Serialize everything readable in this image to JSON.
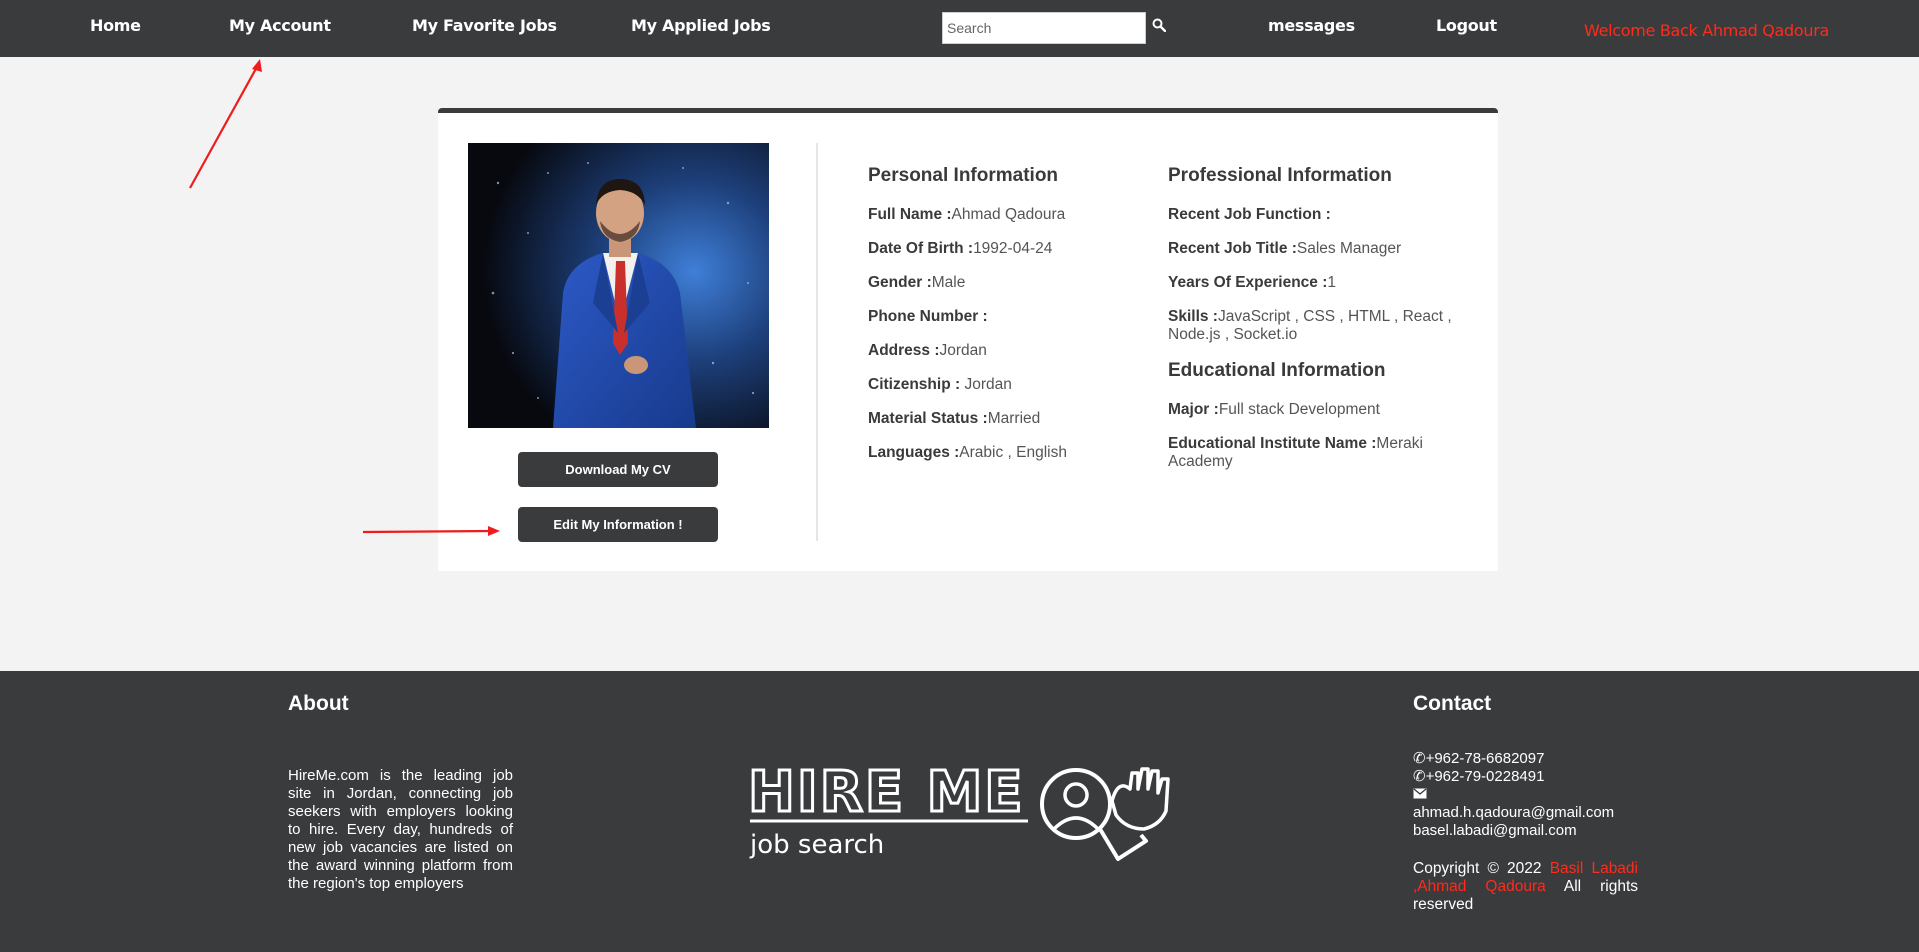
{
  "nav": {
    "home": "Home",
    "my_account": "My Account",
    "favorite_jobs": "My Favorite Jobs",
    "applied_jobs": "My Applied Jobs",
    "search_placeholder": "Search",
    "search_icon": "search-icon",
    "messages": "messages",
    "logout": "Logout",
    "welcome": "Welcome Back Ahmad Qadoura"
  },
  "profile": {
    "download_cv": "Download My CV",
    "edit_info": "Edit My Information !",
    "personal": {
      "title": "Personal Information",
      "fields": [
        {
          "label": "Full Name :",
          "value": "Ahmad Qadoura"
        },
        {
          "label": "Date Of Birth :",
          "value": "1992-04-24"
        },
        {
          "label": "Gender :",
          "value": "Male"
        },
        {
          "label": "Phone Number :",
          "value": ""
        },
        {
          "label": "Address :",
          "value": "Jordan"
        },
        {
          "label": "Citizenship :",
          "value": " Jordan"
        },
        {
          "label": "Material Status :",
          "value": "Married"
        },
        {
          "label": "Languages :",
          "value": "Arabic , English"
        }
      ]
    },
    "professional": {
      "title": "Professional Information",
      "fields": [
        {
          "label": "Recent Job Function :",
          "value": ""
        },
        {
          "label": "Recent Job Title :",
          "value": "Sales Manager"
        },
        {
          "label": "Years Of Experience :",
          "value": "1"
        },
        {
          "label": "Skills :",
          "value": "JavaScript , CSS , HTML , React , Node.js , Socket.io"
        }
      ]
    },
    "educational": {
      "title": "Educational Information",
      "fields": [
        {
          "label": "Major :",
          "value": "Full stack Development"
        },
        {
          "label": "Educational Institute Name :",
          "value": "Meraki Academy"
        }
      ]
    }
  },
  "footer": {
    "about_title": "About",
    "about_text": "HireMe.com is the leading job site in Jordan, connecting job seekers with employers looking to hire. Every day, hundreds of new job vacancies are listed on the award winning platform from the region's top employers",
    "logo_main": "HIRE ME",
    "logo_sub": "job search",
    "contact_title": "Contact",
    "phone1": "+962-78-6682097",
    "phone2": "+962-79-0228491",
    "email1": "ahmad.h.qadoura@gmail.com",
    "email2": "basel.labadi@gmail.com",
    "copyright_prefix": "Copyright © 2022 ",
    "authors": "Basil Labadi ,Ahmad Qadoura",
    "copyright_suffix": " All rights reserved",
    "phone_icon": "phone-icon",
    "mail_icon": "envelope-icon"
  },
  "colors": {
    "nav_bg": "#3a3b3d",
    "accent_red": "#ff2b1c",
    "page_bg": "#f3f3f3"
  }
}
